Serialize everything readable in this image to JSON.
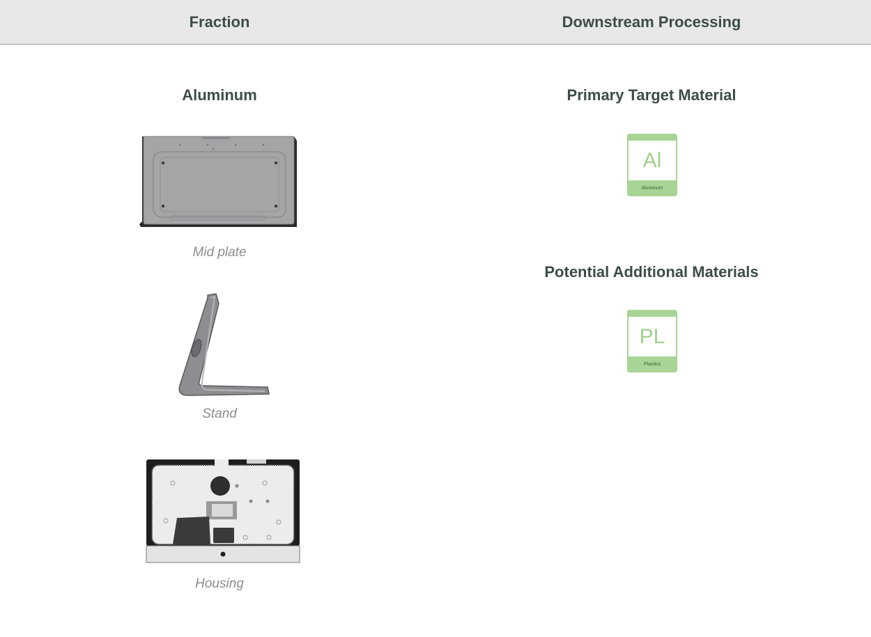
{
  "header": {
    "left_label": "Fraction",
    "right_label": "Downstream Processing"
  },
  "fraction": {
    "title": "Aluminum",
    "parts": [
      {
        "caption": "Mid plate",
        "icon": "mid-plate-image"
      },
      {
        "caption": "Stand",
        "icon": "stand-image"
      },
      {
        "caption": "Housing",
        "icon": "housing-image"
      }
    ]
  },
  "processing": {
    "primary_title": "Primary Target Material",
    "primary_materials": [
      {
        "symbol": "Al",
        "name": "Aluminum"
      }
    ],
    "additional_title": "Potential Additional Materials",
    "additional_materials": [
      {
        "symbol": "PL",
        "name": "Plastics"
      }
    ]
  },
  "colors": {
    "heading": "#3d4c44",
    "header_bg": "#e8e8ea",
    "caption": "#8c8c8c",
    "tile_green": "#a8d596"
  }
}
